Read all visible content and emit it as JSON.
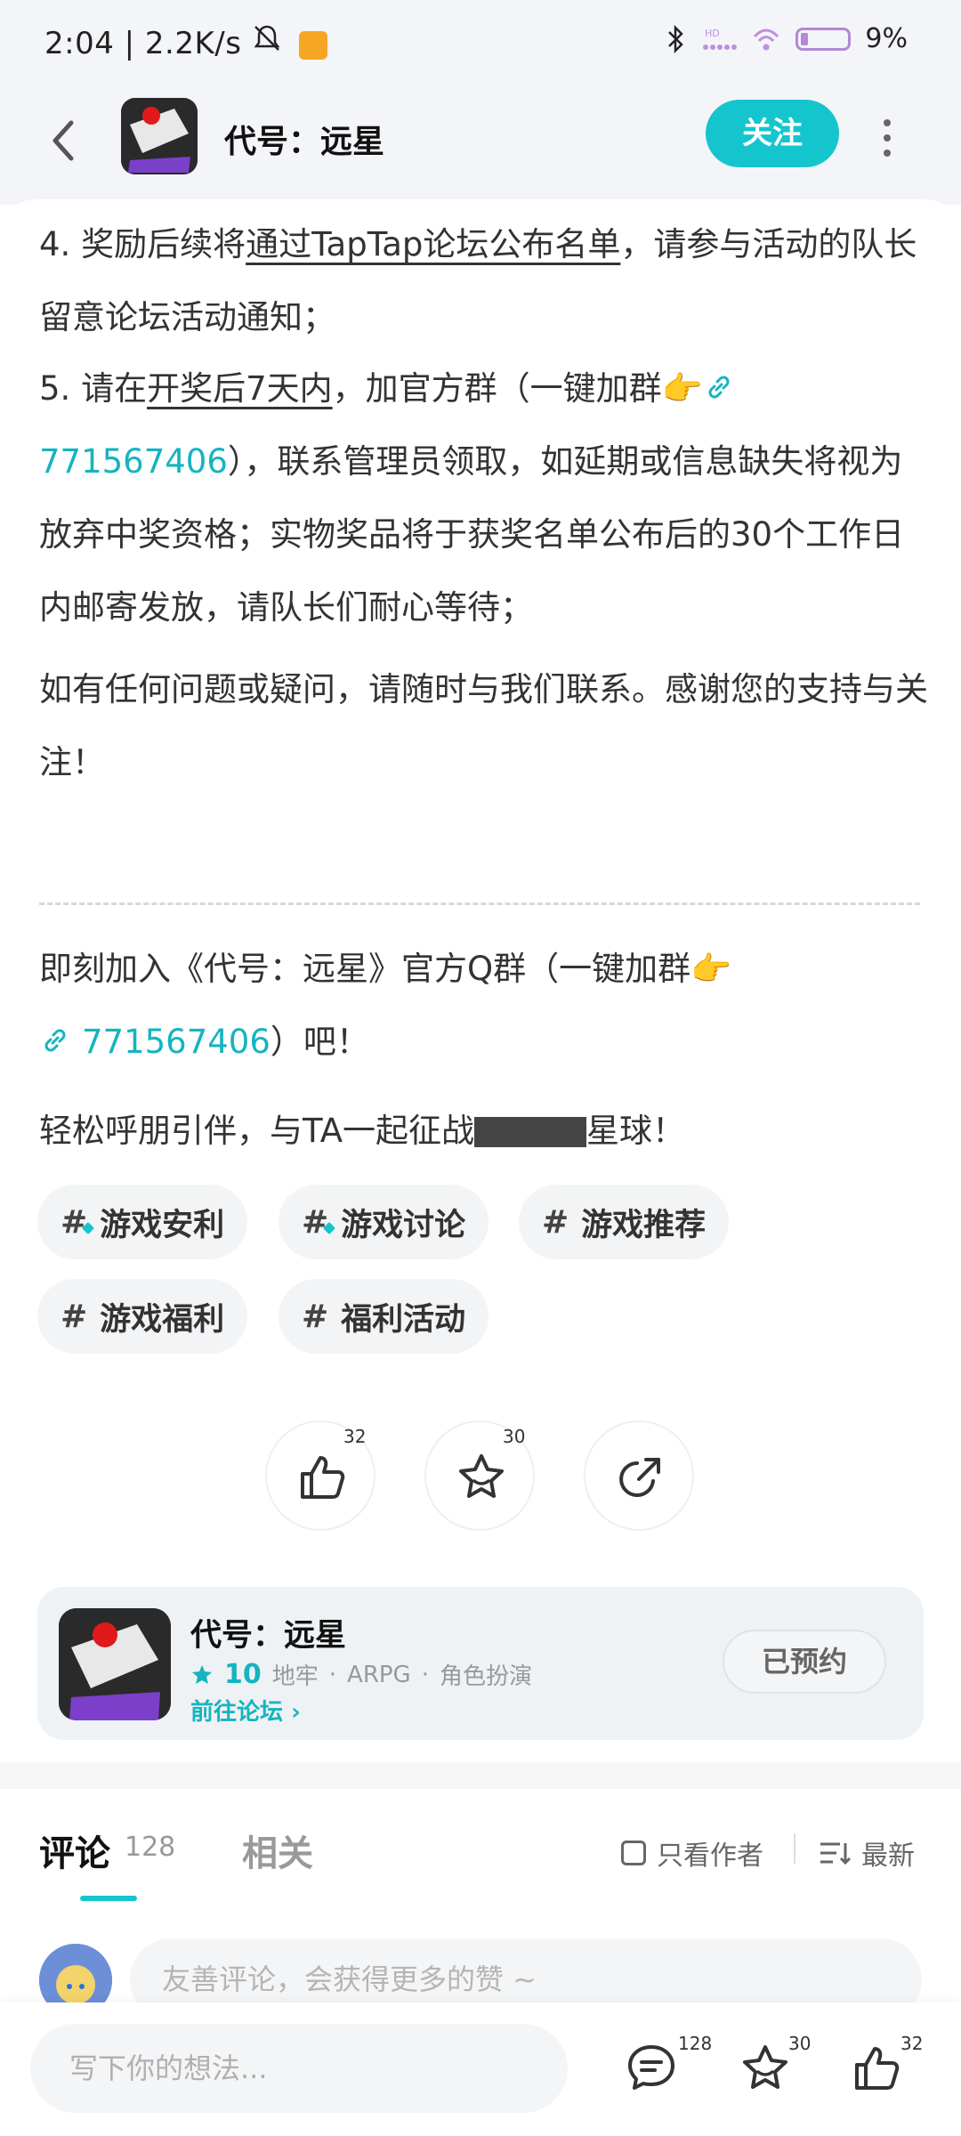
{
  "status_bar": {
    "time": "2:04 | 2.2K/s",
    "battery": "9%"
  },
  "header": {
    "title": "代号：远星",
    "follow_label": "关注"
  },
  "content": {
    "p4_a": "4. 奖励后续将",
    "p4_link": "通过TapTap论坛公布名单",
    "p4_b": "，请参与活动的队长留意论坛活动通知；",
    "p5_a": "5. 请在",
    "p5_link": "开奖后7天内",
    "p5_b": "，加官方群（一键加群👉",
    "p5_qq": "771567406",
    "p5_c": "），联系管理员领取，如延期或信息缺失将视为放弃中奖资格；实物奖品将于获奖名单公布后的30个工作日内邮寄发放，请队长们耐心等待；",
    "contact": "如有任何问题或疑问，请随时与我们联系。感谢您的支持与关注！",
    "join_a": "即刻加入《代号：远星》官方Q群（一键加群👉",
    "join_qq": "771567406",
    "join_b": "）吧！",
    "invite_a": "轻松呼朋引伴，与TA一起征战",
    "invite_b": "星球！"
  },
  "tags": [
    "游戏安利",
    "游戏讨论",
    "游戏推荐",
    "游戏福利",
    "福利活动"
  ],
  "actions": {
    "like_count": "32",
    "favorite_count": "30"
  },
  "game_card": {
    "name": "代号：远星",
    "score": "10",
    "genres": [
      "地牢",
      "ARPG",
      "角色扮演"
    ],
    "forum_label": "前往论坛",
    "reserved_label": "已预约"
  },
  "comments": {
    "tab_comments": "评论",
    "comment_count": "128",
    "tab_related": "相关",
    "author_only": "只看作者",
    "sort_label": "最新",
    "input_placeholder": "友善评论，会获得更多的赞 ~"
  },
  "bottom_bar": {
    "input_placeholder": "写下你的想法...",
    "comment_count": "128",
    "favorite_count": "30",
    "like_count": "32"
  },
  "colors": {
    "accent": "#15c5ce",
    "link": "#15b4bf"
  }
}
